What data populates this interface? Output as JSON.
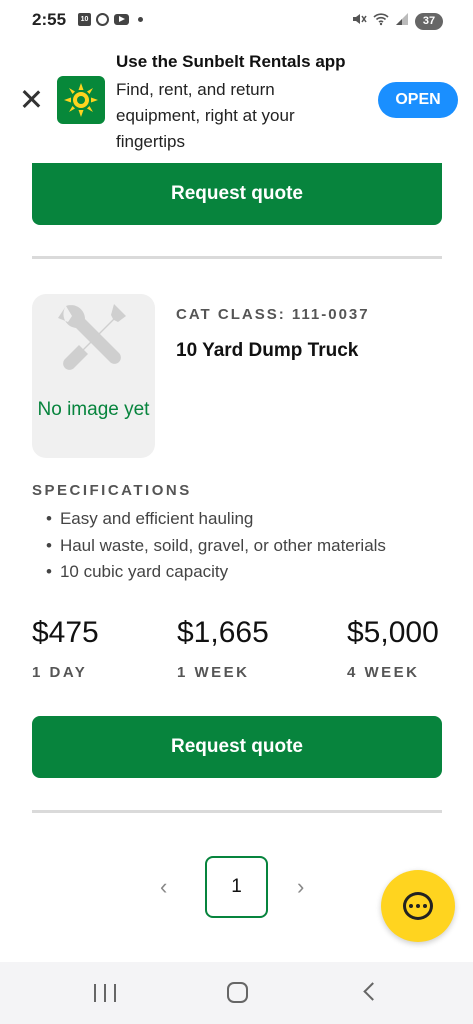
{
  "status_bar": {
    "time": "2:55",
    "notification_badge": "10",
    "battery": "37"
  },
  "app_banner": {
    "title": "Use the Sunbelt Rentals app",
    "description": "Find, rent, and return equipment, right at your fingertips",
    "open_label": "OPEN"
  },
  "top_button": {
    "label": "Request quote"
  },
  "product": {
    "no_image_text": "No image yet",
    "cat_class": "CAT CLASS: 111-0037",
    "name": "10 Yard Dump Truck",
    "spec_heading": "SPECIFICATIONS",
    "specs": [
      "Easy and efficient hauling",
      "Haul waste, soild, gravel, or other materials",
      "10 cubic yard capacity"
    ],
    "prices": [
      {
        "amount": "$475",
        "period": "1 DAY"
      },
      {
        "amount": "$1,665",
        "period": "1 WEEK"
      },
      {
        "amount": "$5,000",
        "period": "4 WEEK"
      }
    ],
    "quote_label": "Request quote"
  },
  "pagination": {
    "prev": "‹",
    "current": "1",
    "next": "›"
  },
  "colors": {
    "brand_green": "#07843d",
    "open_blue": "#1a8fff",
    "chat_yellow": "#ffd41f"
  }
}
